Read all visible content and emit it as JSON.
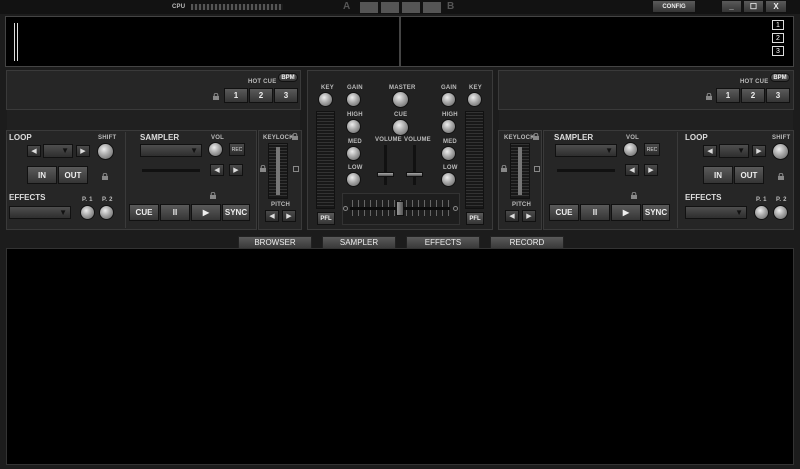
{
  "topbar": {
    "cpu_label": "CPU",
    "deck_a_label": "A",
    "deck_b_label": "B",
    "config_label": "CONFIG",
    "minimize": "_",
    "maximize": "☐",
    "close": "X"
  },
  "waveform": {
    "layout_buttons": [
      "1",
      "2",
      "3"
    ]
  },
  "deck": {
    "hot_cue_label": "HOT CUE",
    "bpm_label": "BPM",
    "hot_cues": [
      "1",
      "2",
      "3"
    ],
    "loop_label": "LOOP",
    "shift_label": "SHIFT",
    "in_label": "IN",
    "out_label": "OUT",
    "sampler_label": "SAMPLER",
    "vol_label": "VOL",
    "rec_label": "REC",
    "effects_label": "EFFECTS",
    "p1_label": "P. 1",
    "p2_label": "P. 2",
    "cue_label": "CUE",
    "pause_label": "II",
    "play_label": "▶",
    "sync_label": "SYNC",
    "keylock_label": "KEYLOCK",
    "pitch_label": "PITCH"
  },
  "mixer": {
    "key_label": "KEY",
    "gain_label": "GAIN",
    "high_label": "HIGH",
    "med_label": "MED",
    "low_label": "LOW",
    "master_label": "MASTER",
    "cue_label": "CUE",
    "volume_label": "VOLUME",
    "pfl_label": "PFL"
  },
  "tabs": [
    "BROWSER",
    "SAMPLER",
    "EFFECTS",
    "RECORD"
  ]
}
